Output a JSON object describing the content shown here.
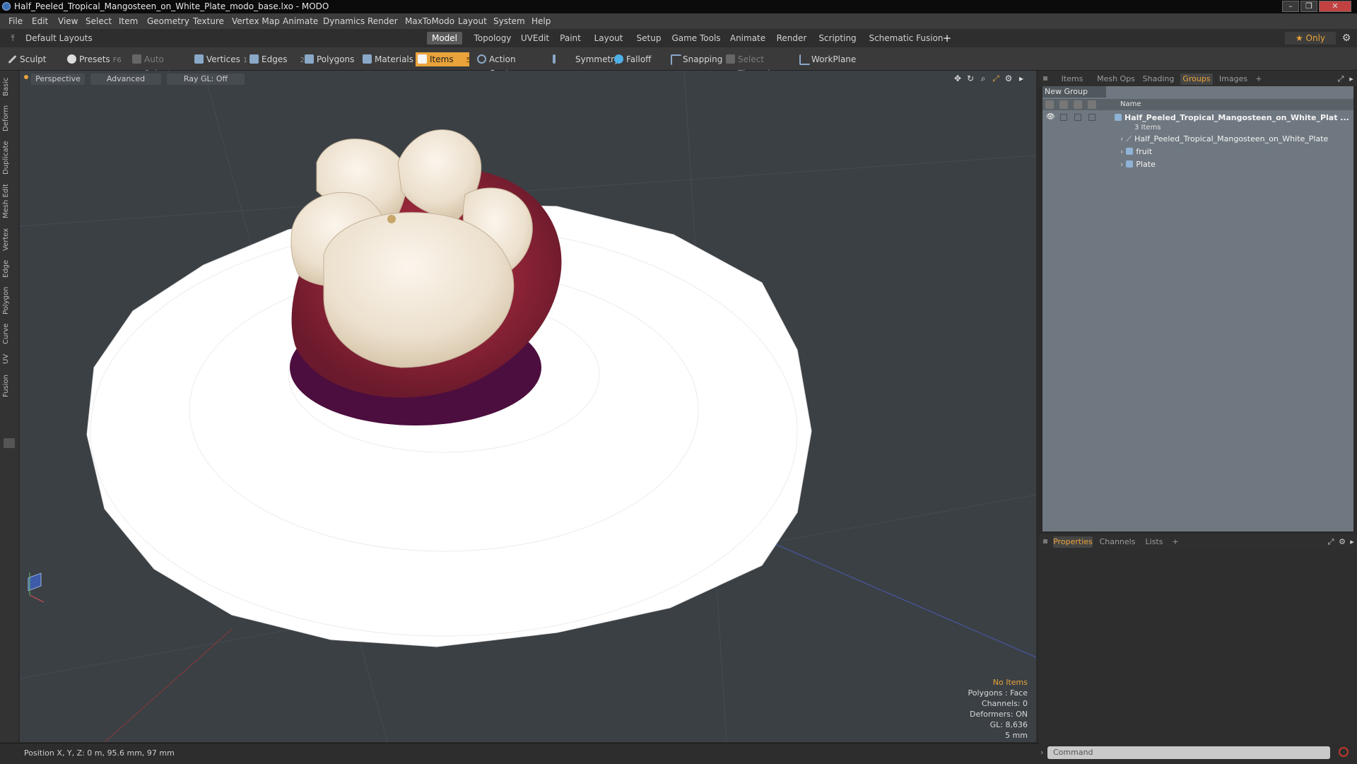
{
  "window": {
    "title": "Half_Peeled_Tropical_Mangosteen_on_White_Plate_modo_base.lxo - MODO",
    "controls": [
      "–",
      "❐",
      "✕"
    ]
  },
  "menu": [
    "File",
    "Edit",
    "View",
    "Select",
    "Item",
    "Geometry",
    "Texture",
    "Vertex Map",
    "Animate",
    "Dynamics",
    "Render",
    "MaxToModo",
    "Layout",
    "System",
    "Help"
  ],
  "layout_bar": {
    "layouts_label": "Default Layouts ▾",
    "tabs": [
      "Model",
      "Topology",
      "UVEdit",
      "Paint",
      "Layout",
      "Setup",
      "Game Tools",
      "Animate",
      "Render",
      "Scripting",
      "Schematic Fusion"
    ],
    "active_tab": "Model",
    "add_tab": "+",
    "only_label": "★  Only",
    "settings_icon": "gear-icon"
  },
  "toolbar": {
    "sculpt": "Sculpt",
    "presets": "Presets",
    "presets_key": "F6",
    "auto_select": "Auto Select",
    "vertices": "Vertices",
    "vertices_count": "1",
    "edges": "Edges",
    "edges_count": "2",
    "polygons": "Polygons",
    "materials": "Materials",
    "items": "Items",
    "items_count": "5",
    "action_center": "Action Center",
    "symmetry": "Symmetry",
    "falloff": "Falloff",
    "snapping": "Snapping",
    "select_through": "Select Through",
    "workplane": "WorkPlane"
  },
  "left_tabs": [
    "Basic",
    "Deform",
    "Duplicate",
    "Mesh Edit",
    "Vertex",
    "Edge",
    "Polygon",
    "Curve",
    "UV",
    "Fusion"
  ],
  "viewport": {
    "view_mode": "Perspective",
    "shading": "Advanced",
    "raygl": "Ray GL: Off",
    "info": {
      "selection": "No Items",
      "polygons": "Polygons : Face",
      "channels": "Channels: 0",
      "deformers": "Deformers: ON",
      "gl": "GL: 8,636",
      "grid": "5 mm"
    }
  },
  "status_bar": {
    "position": "Position X, Y, Z:  0 m, 95.6 mm, 97 mm"
  },
  "right_panel": {
    "top_tabs": [
      "Items",
      "Mesh Ops",
      "Shading",
      "Groups",
      "Images"
    ],
    "active_top_tab": "Groups",
    "add_tab": "+",
    "new_group": "New Group",
    "name_column": "Name",
    "group": {
      "name": "Half_Peeled_Tropical_Mangosteen_on_White_Plat ...",
      "count": "3 Items",
      "children": [
        "Half_Peeled_Tropical_Mangosteen_on_White_Plate",
        "fruit",
        "Plate"
      ]
    },
    "bottom_tabs": [
      "Properties",
      "Channels",
      "Lists"
    ],
    "active_bottom_tab": "Properties",
    "command_placeholder": "Command"
  },
  "colors": {
    "accent": "#e9a33a",
    "viewport_bg": "#3b4045",
    "groups_bg": "#6f7880"
  }
}
